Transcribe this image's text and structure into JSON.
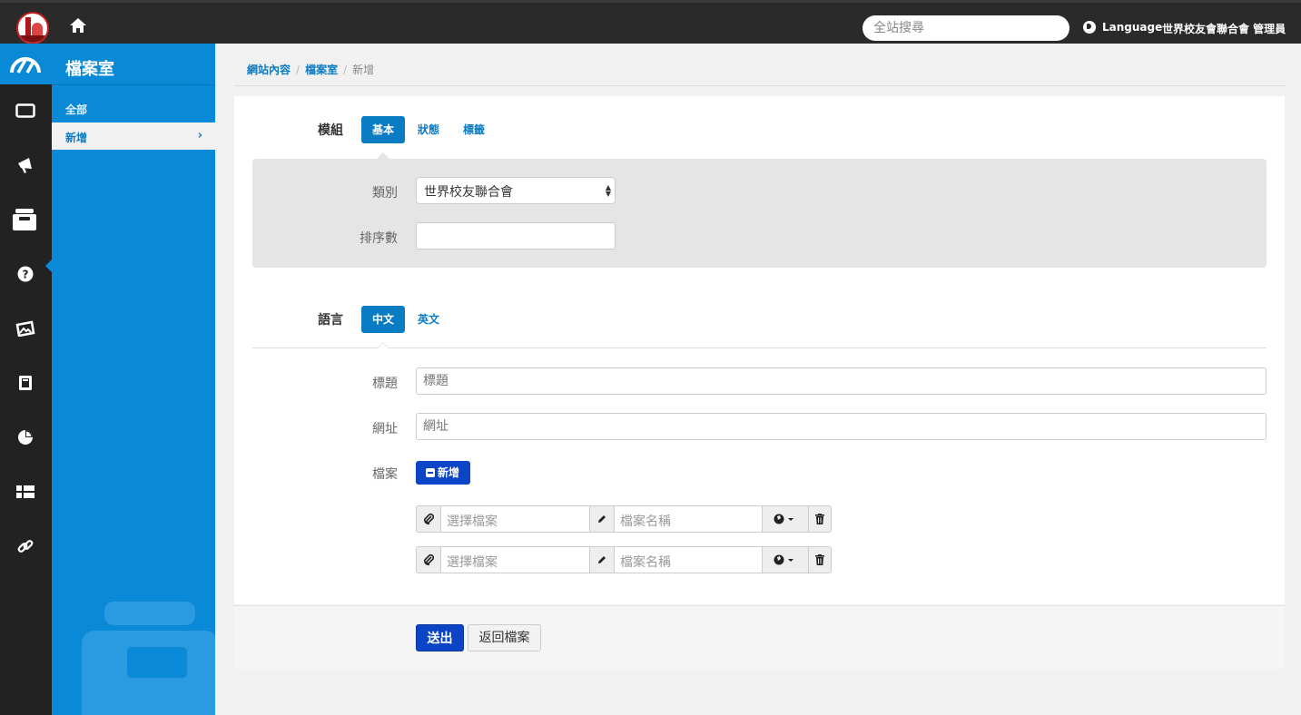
{
  "topbar": {
    "search_placeholder": "全站搜尋",
    "language_label": "Language",
    "user_label": "世界校友會聯合會 管理員"
  },
  "sidebar": {
    "title": "檔案室",
    "items": [
      {
        "label": "全部"
      },
      {
        "label": "新增",
        "active": true
      }
    ]
  },
  "breadcrumb": {
    "items": [
      "網站內容",
      "檔案室",
      "新增"
    ]
  },
  "module": {
    "label": "模組",
    "tabs": [
      "基本",
      "狀態",
      "標籤"
    ],
    "active_tab": "基本",
    "fields": {
      "category_label": "類別",
      "category_value": "世界校友聯合會",
      "order_label": "排序數",
      "order_value": ""
    }
  },
  "language": {
    "label": "語言",
    "tabs": [
      "中文",
      "英文"
    ],
    "active_tab": "中文",
    "fields": {
      "title_label": "標題",
      "title_placeholder": "標題",
      "url_label": "網址",
      "url_placeholder": "網址",
      "file_label": "檔案",
      "add_button": "新增"
    },
    "file_rows": [
      {
        "file_placeholder": "選擇檔案",
        "name_placeholder": "檔案名稱"
      },
      {
        "file_placeholder": "選擇檔案",
        "name_placeholder": "檔案名稱"
      }
    ]
  },
  "actions": {
    "submit": "送出",
    "back": "返回檔案"
  },
  "colors": {
    "accent": "#0a8ad6",
    "primary_button": "#0b44c4",
    "topbar": "#2a2a2a",
    "rail": "#222222"
  }
}
